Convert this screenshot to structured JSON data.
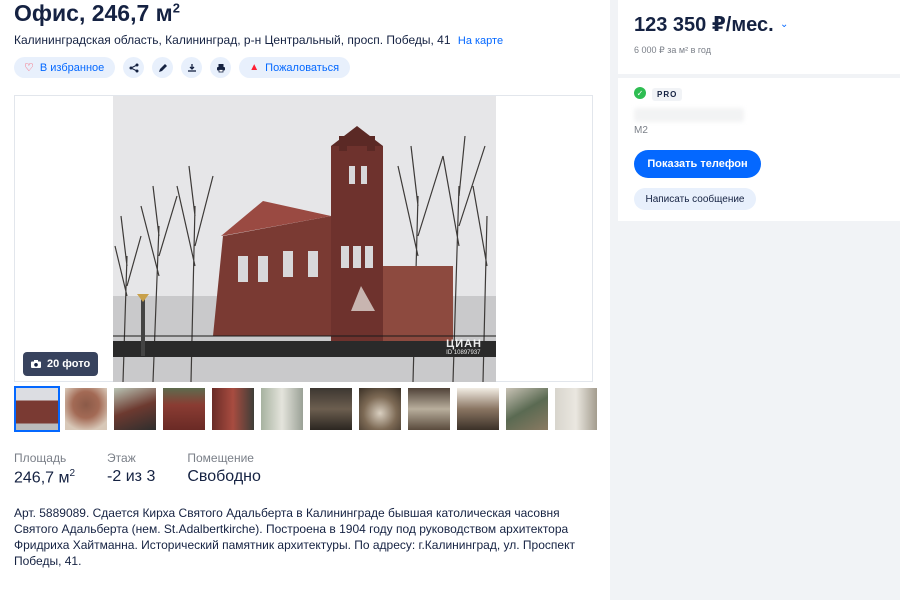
{
  "listing": {
    "title": "Офис, 246,7 м",
    "title_sup": "2",
    "address": "Калининградская область, Калининград, р-н Центральный, просп. Победы, 41",
    "map_link": "На карте"
  },
  "actions": {
    "favorite": "В избранное",
    "report": "Пожаловаться"
  },
  "gallery": {
    "photo_count": "20 фото",
    "watermark": "ЦИАН",
    "watermark_id": "ID 10897937",
    "thumbnail_count": 12
  },
  "facts": [
    {
      "label": "Площадь",
      "value": "246,7 м",
      "sup": "2"
    },
    {
      "label": "Этаж",
      "value": "-2 из 3",
      "sup": ""
    },
    {
      "label": "Помещение",
      "value": "Свободно",
      "sup": ""
    }
  ],
  "description": "Арт. 5889089. Сдается Кирха Святого Адальберта в Калининграде бывшая католическая часовня Святого Адальберта (нем. St.Adalbertkirche). Построена в 1904 году под руководством архитектора Фридриха Хайтманна. Исторический памятник архитектуры. По адресу: г.Калининград, ул. Проспект Победы, 41.",
  "sidebar": {
    "price": "123 350 ₽/мес.",
    "price_per_m2": "6 000 ₽ за м² в год",
    "badge": "PRO",
    "agent_sub": "М2",
    "show_phone": "Показать телефон",
    "write_message": "Написать сообщение"
  },
  "colors": {
    "accent": "#0468ff",
    "accent_light": "#e8f0fc",
    "text": "#152242",
    "muted": "#7a7f88",
    "verified": "#2ebd52"
  }
}
